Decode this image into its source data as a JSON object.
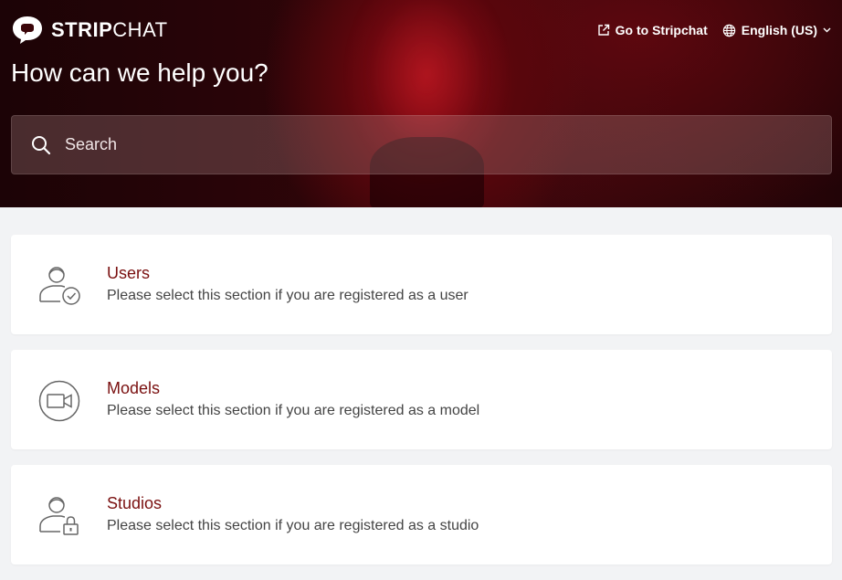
{
  "brand": {
    "name_bold": "STRIP",
    "name_light": "CHAT"
  },
  "header": {
    "go_to_label": "Go to Stripchat",
    "language_label": "English (US)"
  },
  "hero": {
    "title": "How can we help you?"
  },
  "search": {
    "placeholder": "Search"
  },
  "sections": [
    {
      "title": "Users",
      "description": "Please select this section if you are registered as a user",
      "icon": "user-check-icon"
    },
    {
      "title": "Models",
      "description": "Please select this section if you are registered as a model",
      "icon": "video-camera-icon"
    },
    {
      "title": "Studios",
      "description": "Please select this section if you are registered as a studio",
      "icon": "user-lock-icon"
    }
  ],
  "colors": {
    "accent": "#7a1010",
    "hero_bg": "#2e0509",
    "page_bg": "#f2f3f5",
    "card_bg": "#ffffff"
  }
}
